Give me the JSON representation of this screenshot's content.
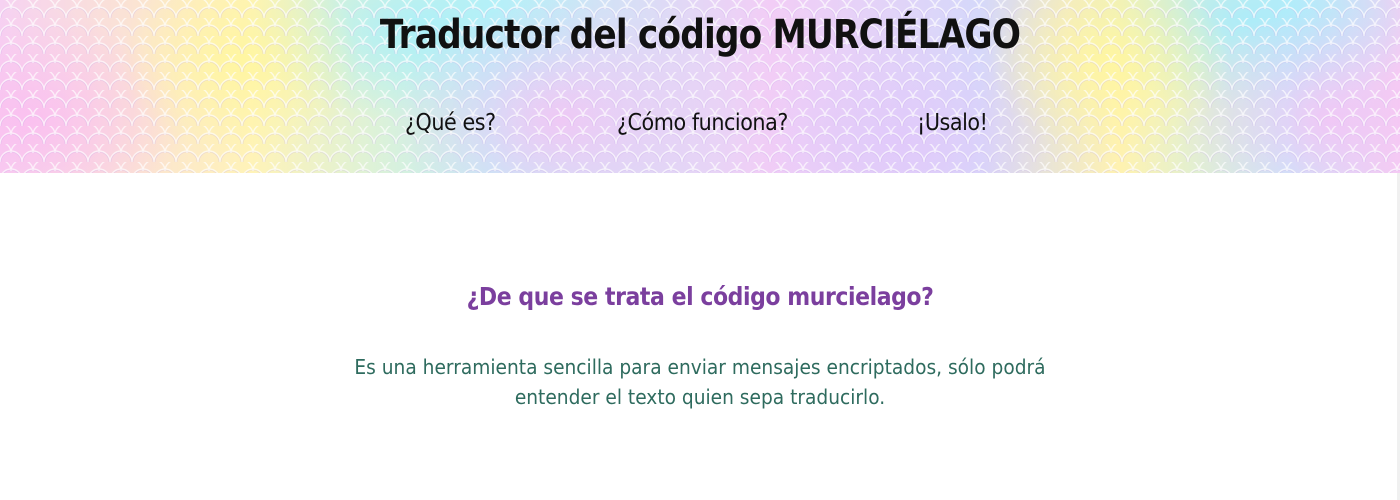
{
  "header": {
    "title": "Traductor del código MURCIÉLAGO",
    "background_colors": [
      "#f6d2f2",
      "#fff3b8",
      "#bdf0f6",
      "#d5d8fa"
    ],
    "nav": [
      {
        "label": "¿Qué es?"
      },
      {
        "label": "¿Cómo funciona?"
      },
      {
        "label": "¡Usalo!"
      }
    ]
  },
  "main": {
    "section_title": "¿De que se trata el código murcielago?",
    "section_text": "Es una herramienta sencilla para enviar mensajes encriptados, sólo podrá entender el texto quien sepa traducirlo.",
    "title_color": "#7b3f9e",
    "text_color": "#2e6b5e"
  }
}
